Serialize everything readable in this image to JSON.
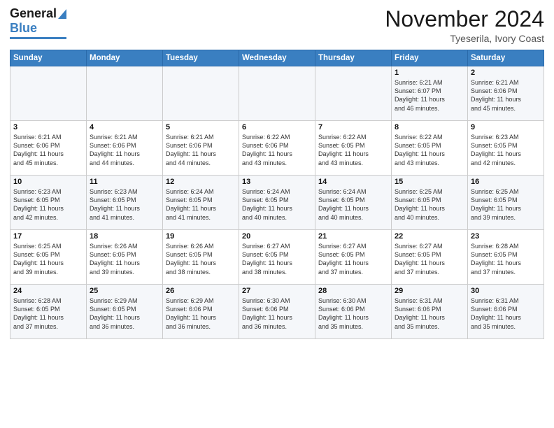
{
  "header": {
    "logo_line1": "General",
    "logo_line2": "Blue",
    "month": "November 2024",
    "location": "Tyeserila, Ivory Coast"
  },
  "weekdays": [
    "Sunday",
    "Monday",
    "Tuesday",
    "Wednesday",
    "Thursday",
    "Friday",
    "Saturday"
  ],
  "weeks": [
    [
      {
        "day": "",
        "info": ""
      },
      {
        "day": "",
        "info": ""
      },
      {
        "day": "",
        "info": ""
      },
      {
        "day": "",
        "info": ""
      },
      {
        "day": "",
        "info": ""
      },
      {
        "day": "1",
        "info": "Sunrise: 6:21 AM\nSunset: 6:07 PM\nDaylight: 11 hours\nand 46 minutes."
      },
      {
        "day": "2",
        "info": "Sunrise: 6:21 AM\nSunset: 6:06 PM\nDaylight: 11 hours\nand 45 minutes."
      }
    ],
    [
      {
        "day": "3",
        "info": "Sunrise: 6:21 AM\nSunset: 6:06 PM\nDaylight: 11 hours\nand 45 minutes."
      },
      {
        "day": "4",
        "info": "Sunrise: 6:21 AM\nSunset: 6:06 PM\nDaylight: 11 hours\nand 44 minutes."
      },
      {
        "day": "5",
        "info": "Sunrise: 6:21 AM\nSunset: 6:06 PM\nDaylight: 11 hours\nand 44 minutes."
      },
      {
        "day": "6",
        "info": "Sunrise: 6:22 AM\nSunset: 6:06 PM\nDaylight: 11 hours\nand 43 minutes."
      },
      {
        "day": "7",
        "info": "Sunrise: 6:22 AM\nSunset: 6:05 PM\nDaylight: 11 hours\nand 43 minutes."
      },
      {
        "day": "8",
        "info": "Sunrise: 6:22 AM\nSunset: 6:05 PM\nDaylight: 11 hours\nand 43 minutes."
      },
      {
        "day": "9",
        "info": "Sunrise: 6:23 AM\nSunset: 6:05 PM\nDaylight: 11 hours\nand 42 minutes."
      }
    ],
    [
      {
        "day": "10",
        "info": "Sunrise: 6:23 AM\nSunset: 6:05 PM\nDaylight: 11 hours\nand 42 minutes."
      },
      {
        "day": "11",
        "info": "Sunrise: 6:23 AM\nSunset: 6:05 PM\nDaylight: 11 hours\nand 41 minutes."
      },
      {
        "day": "12",
        "info": "Sunrise: 6:24 AM\nSunset: 6:05 PM\nDaylight: 11 hours\nand 41 minutes."
      },
      {
        "day": "13",
        "info": "Sunrise: 6:24 AM\nSunset: 6:05 PM\nDaylight: 11 hours\nand 40 minutes."
      },
      {
        "day": "14",
        "info": "Sunrise: 6:24 AM\nSunset: 6:05 PM\nDaylight: 11 hours\nand 40 minutes."
      },
      {
        "day": "15",
        "info": "Sunrise: 6:25 AM\nSunset: 6:05 PM\nDaylight: 11 hours\nand 40 minutes."
      },
      {
        "day": "16",
        "info": "Sunrise: 6:25 AM\nSunset: 6:05 PM\nDaylight: 11 hours\nand 39 minutes."
      }
    ],
    [
      {
        "day": "17",
        "info": "Sunrise: 6:25 AM\nSunset: 6:05 PM\nDaylight: 11 hours\nand 39 minutes."
      },
      {
        "day": "18",
        "info": "Sunrise: 6:26 AM\nSunset: 6:05 PM\nDaylight: 11 hours\nand 39 minutes."
      },
      {
        "day": "19",
        "info": "Sunrise: 6:26 AM\nSunset: 6:05 PM\nDaylight: 11 hours\nand 38 minutes."
      },
      {
        "day": "20",
        "info": "Sunrise: 6:27 AM\nSunset: 6:05 PM\nDaylight: 11 hours\nand 38 minutes."
      },
      {
        "day": "21",
        "info": "Sunrise: 6:27 AM\nSunset: 6:05 PM\nDaylight: 11 hours\nand 37 minutes."
      },
      {
        "day": "22",
        "info": "Sunrise: 6:27 AM\nSunset: 6:05 PM\nDaylight: 11 hours\nand 37 minutes."
      },
      {
        "day": "23",
        "info": "Sunrise: 6:28 AM\nSunset: 6:05 PM\nDaylight: 11 hours\nand 37 minutes."
      }
    ],
    [
      {
        "day": "24",
        "info": "Sunrise: 6:28 AM\nSunset: 6:05 PM\nDaylight: 11 hours\nand 37 minutes."
      },
      {
        "day": "25",
        "info": "Sunrise: 6:29 AM\nSunset: 6:05 PM\nDaylight: 11 hours\nand 36 minutes."
      },
      {
        "day": "26",
        "info": "Sunrise: 6:29 AM\nSunset: 6:06 PM\nDaylight: 11 hours\nand 36 minutes."
      },
      {
        "day": "27",
        "info": "Sunrise: 6:30 AM\nSunset: 6:06 PM\nDaylight: 11 hours\nand 36 minutes."
      },
      {
        "day": "28",
        "info": "Sunrise: 6:30 AM\nSunset: 6:06 PM\nDaylight: 11 hours\nand 35 minutes."
      },
      {
        "day": "29",
        "info": "Sunrise: 6:31 AM\nSunset: 6:06 PM\nDaylight: 11 hours\nand 35 minutes."
      },
      {
        "day": "30",
        "info": "Sunrise: 6:31 AM\nSunset: 6:06 PM\nDaylight: 11 hours\nand 35 minutes."
      }
    ]
  ]
}
